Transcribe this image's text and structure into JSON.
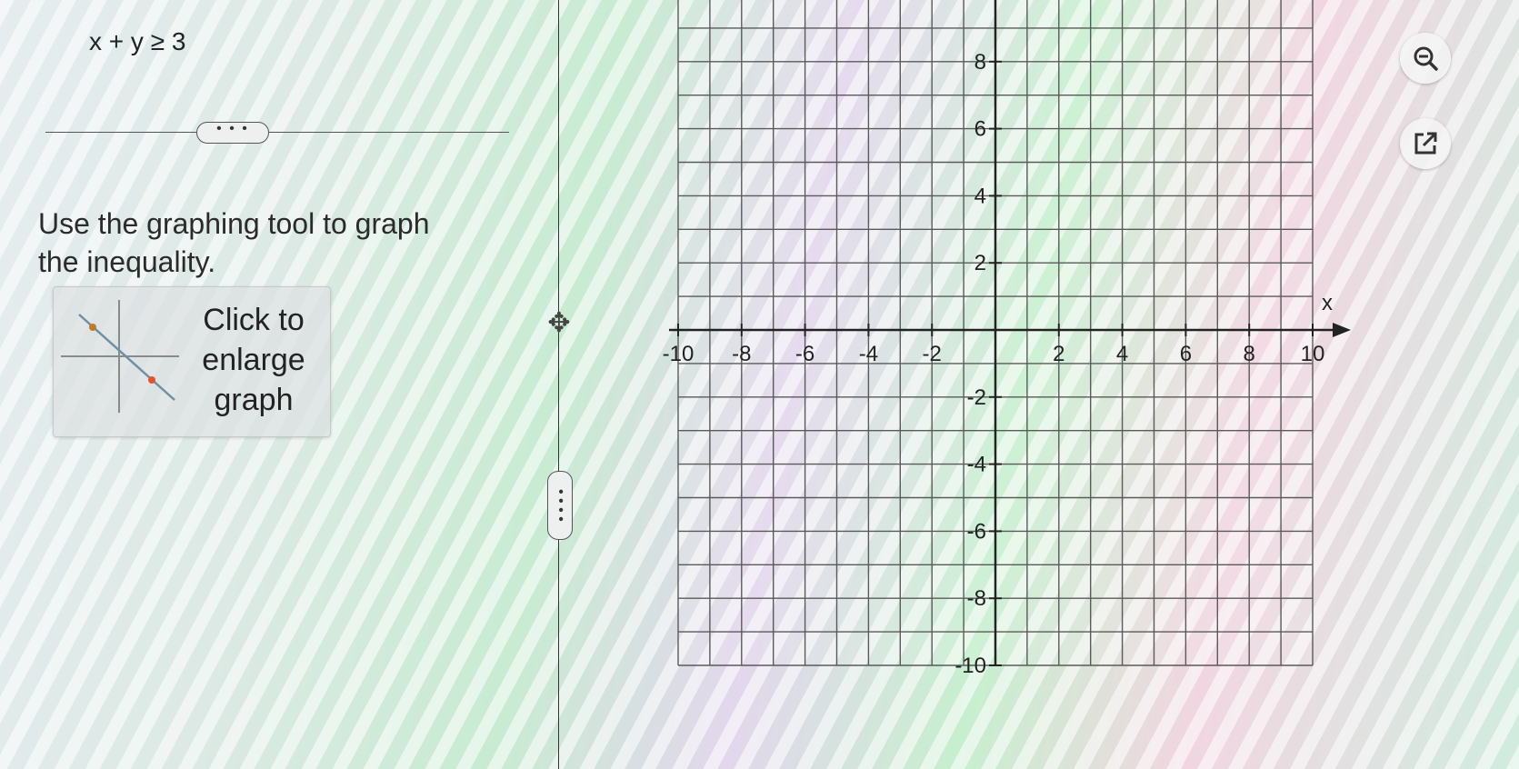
{
  "problem": {
    "inequality": "x + y ≥ 3"
  },
  "divider": {
    "handle_label": "• • •",
    "vertical_handle_label": "• • • •"
  },
  "instructions": {
    "text": "Use the graphing tool to graph the inequality."
  },
  "enlarge_button": {
    "label_line1": "Click to",
    "label_line2": "enlarge",
    "label_line3": "graph"
  },
  "graph": {
    "x_axis_label": "x",
    "x_ticks": [
      "-10",
      "-8",
      "-6",
      "-4",
      "-2",
      "2",
      "4",
      "6",
      "8",
      "10"
    ],
    "y_ticks": [
      "8",
      "6",
      "4",
      "2",
      "-2",
      "-4",
      "-6",
      "-8",
      "-10"
    ],
    "x_range": [
      -10,
      10
    ],
    "y_range": [
      -10,
      10
    ],
    "grid": true
  },
  "toolbar": {
    "zoom_icon": "zoom-out-icon",
    "popout_icon": "external-link-icon"
  }
}
